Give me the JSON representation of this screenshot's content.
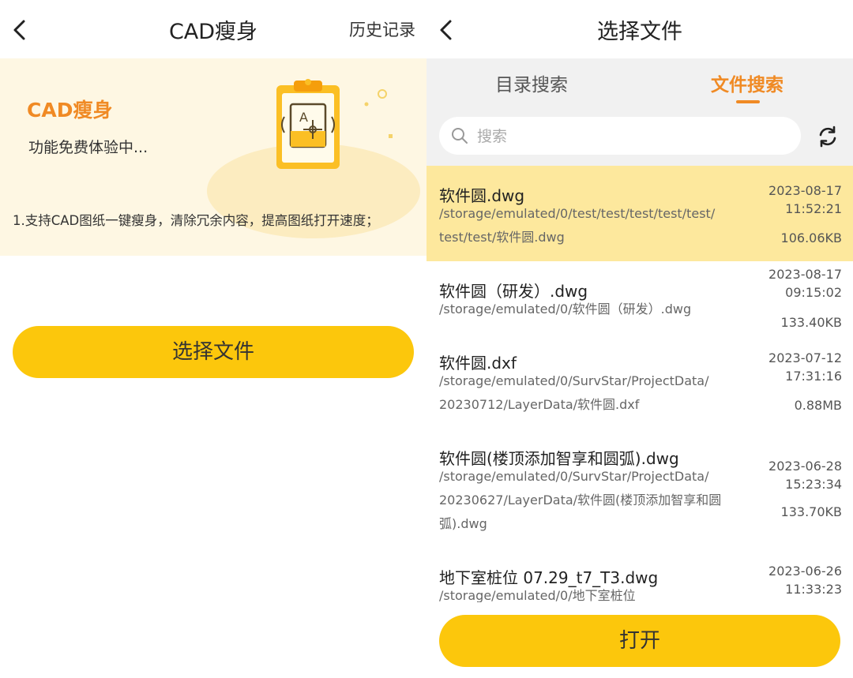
{
  "colors": {
    "accent_yellow": "#fcc70c",
    "accent_orange": "#f08a24",
    "banner_bg": "#fef7e3",
    "selected_row": "#fde89d"
  },
  "left": {
    "header": {
      "title": "CAD瘦身",
      "history_label": "历史记录",
      "back_icon": "chevron-left-icon"
    },
    "banner": {
      "title": "CAD瘦身",
      "subtitle": "功能免费体验中...",
      "description": "1.支持CAD图纸一键瘦身，清除冗余内容，提高图纸打开速度；",
      "icon": "clipboard-icon",
      "icon_text": "A"
    },
    "select_button_label": "选择文件"
  },
  "right": {
    "header": {
      "title": "选择文件",
      "back_icon": "chevron-left-icon"
    },
    "tabs": [
      {
        "label": "目录搜索",
        "active": false
      },
      {
        "label": "文件搜索",
        "active": true
      }
    ],
    "search": {
      "placeholder": "搜索",
      "value": ""
    },
    "refresh_icon": "refresh-icon",
    "files": [
      {
        "name": "软件圆.dwg",
        "path_lines": [
          "/storage/emulated/0/test/test/test/test/test/",
          "test/test/软件圆.dwg"
        ],
        "date": "2023-08-17",
        "time": "11:52:21",
        "size": "106.06KB",
        "selected": true
      },
      {
        "name": "软件圆（研发）.dwg",
        "path_lines": [
          "/storage/emulated/0/软件圆（研发）.dwg"
        ],
        "date": "2023-08-17",
        "time": "09:15:02",
        "size": "133.40KB",
        "selected": false
      },
      {
        "name": "软件圆.dxf",
        "path_lines": [
          "/storage/emulated/0/SurvStar/ProjectData/",
          "20230712/LayerData/软件圆.dxf"
        ],
        "date": "2023-07-12",
        "time": "17:31:16",
        "size": "0.88MB",
        "selected": false
      },
      {
        "name": "软件圆(楼顶添加智享和圆弧).dwg",
        "path_lines": [
          "/storage/emulated/0/SurvStar/ProjectData/",
          "20230627/LayerData/软件圆(楼顶添加智享和圆",
          "弧).dwg"
        ],
        "date": "2023-06-28",
        "time": "15:23:34",
        "size": "133.70KB",
        "selected": false
      },
      {
        "name": "地下室桩位 07.29_t7_T3.dwg",
        "path_lines": [
          "/storage/emulated/0/地下室桩位"
        ],
        "date": "2023-06-26",
        "time": "11:33:23",
        "size": "",
        "selected": false
      }
    ],
    "open_button_label": "打开"
  }
}
